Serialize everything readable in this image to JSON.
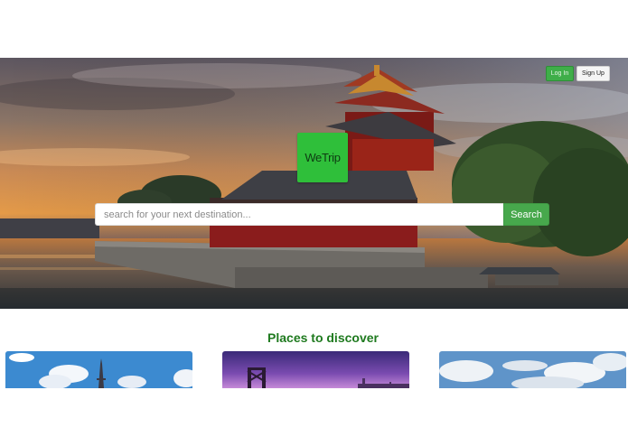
{
  "header": {
    "login_label": "Log In",
    "signup_label": "Sign Up"
  },
  "hero": {
    "logo_text": "WeTrip",
    "search": {
      "placeholder": "search for your next destination...",
      "button_label": "Search"
    }
  },
  "places": {
    "title": "Places to discover",
    "cards": [
      {
        "image": "paris-eiffel-tower-image"
      },
      {
        "image": "bridge-night-skyline-image"
      },
      {
        "image": "cloudy-sky-landscape-image"
      }
    ]
  },
  "colors": {
    "accent_green": "#47a84c",
    "title_green": "#1f7a1f",
    "logo_green": "#2fbf3a"
  }
}
